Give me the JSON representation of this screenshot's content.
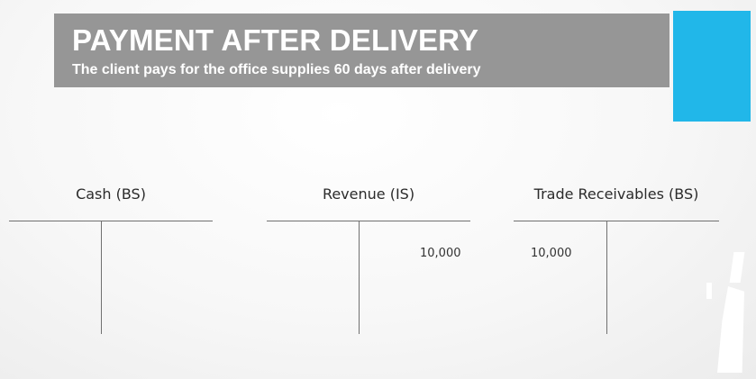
{
  "slide": {
    "title": "PAYMENT AFTER DELIVERY",
    "subtitle": "The client pays for the office supplies 60 days after delivery",
    "accent_color": "#21b7e9",
    "banner_color": "#969696"
  },
  "accounts": [
    {
      "label": "Cash (BS)",
      "debit": "",
      "credit": ""
    },
    {
      "label": "Revenue (IS)",
      "debit": "",
      "credit": "10,000"
    },
    {
      "label": "Trade Receivables (BS)",
      "debit": "10,000",
      "credit": ""
    }
  ]
}
